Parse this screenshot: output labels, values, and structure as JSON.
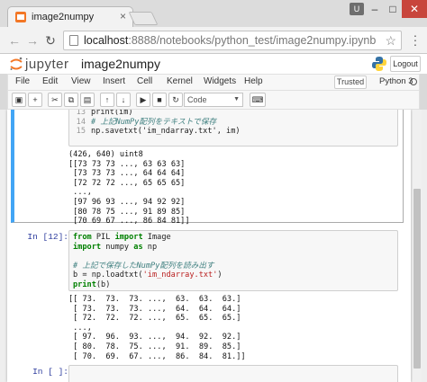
{
  "browser": {
    "tab_title": "image2numpy",
    "tab_close": "×",
    "user_badge": "U",
    "minimize": "–",
    "maximize": "□",
    "close": "✕",
    "url_host": "localhost",
    "url_rest": ":8888/notebooks/python_test/image2numpy.ipynb",
    "icons": [
      "back-arrow-icon",
      "forward-arrow-icon",
      "reload-icon",
      "page-icon",
      "star-icon",
      "menu-dots-icon"
    ]
  },
  "jupyter": {
    "logo_text": "jupyter",
    "notebook_title": "image2numpy",
    "logout_label": "Logout",
    "menu": [
      "File",
      "Edit",
      "View",
      "Insert",
      "Cell",
      "Kernel",
      "Widgets",
      "Help"
    ],
    "trusted_label": "Trusted",
    "kernel_name": "Python 3",
    "toolbar_buttons": [
      {
        "name": "save-icon",
        "glyph": "🖫"
      },
      {
        "name": "add-cell-icon",
        "glyph": "+"
      },
      {
        "name": "cut-icon",
        "glyph": "✂"
      },
      {
        "name": "copy-icon",
        "glyph": "⧉"
      },
      {
        "name": "paste-icon",
        "glyph": "📋"
      },
      {
        "name": "move-up-icon",
        "glyph": "↑"
      },
      {
        "name": "move-down-icon",
        "glyph": "↓"
      },
      {
        "name": "run-icon",
        "glyph": "▶"
      },
      {
        "name": "stop-icon",
        "glyph": "■"
      },
      {
        "name": "restart-icon",
        "glyph": "↻"
      },
      {
        "name": "keyboard-icon",
        "glyph": "⌨"
      }
    ],
    "cell_type": "Code"
  },
  "cells": {
    "cell1": {
      "lines": [
        {
          "n": "13",
          "text": "print(im)"
        },
        {
          "n": "14",
          "text": "# 上記NumPy配列をテキストで保存"
        },
        {
          "n": "15",
          "text": "np.savetxt('im_ndarray.txt', im)"
        }
      ],
      "output": "(426, 640) uint8\n[[73 73 73 ..., 63 63 63]\n [73 73 73 ..., 64 64 64]\n [72 72 72 ..., 65 65 65]\n ...,\n [97 96 93 ..., 94 92 92]\n [80 78 75 ..., 91 89 85]\n [70 69 67 ..., 86 84 81]]"
    },
    "cell2": {
      "prompt": "In [12]:",
      "lines": [
        {
          "n": "",
          "text": "from PIL import Image"
        },
        {
          "n": "",
          "text": "import numpy as np"
        },
        {
          "n": "",
          "text": ""
        },
        {
          "n": "",
          "text": "# 上記で保存したNumPy配列を読み出す"
        },
        {
          "n": "",
          "text": "b = np.loadtxt('im_ndarray.txt')"
        },
        {
          "n": "",
          "text": "print(b)"
        }
      ],
      "output": "[[ 73.  73.  73. ...,  63.  63.  63.]\n [ 73.  73.  73. ...,  64.  64.  64.]\n [ 72.  72.  72. ...,  65.  65.  65.]\n ...,\n [ 97.  96.  93. ...,  94.  92.  92.]\n [ 80.  78.  75. ...,  91.  89.  85.]\n [ 70.  69.  67. ...,  86.  84.  81.]]"
    },
    "cell3": {
      "prompt": "In [ ]:"
    }
  },
  "colors": {
    "selected_border": "#42a5f5",
    "close_button": "#c8453c",
    "prompt": "#303f9f"
  }
}
